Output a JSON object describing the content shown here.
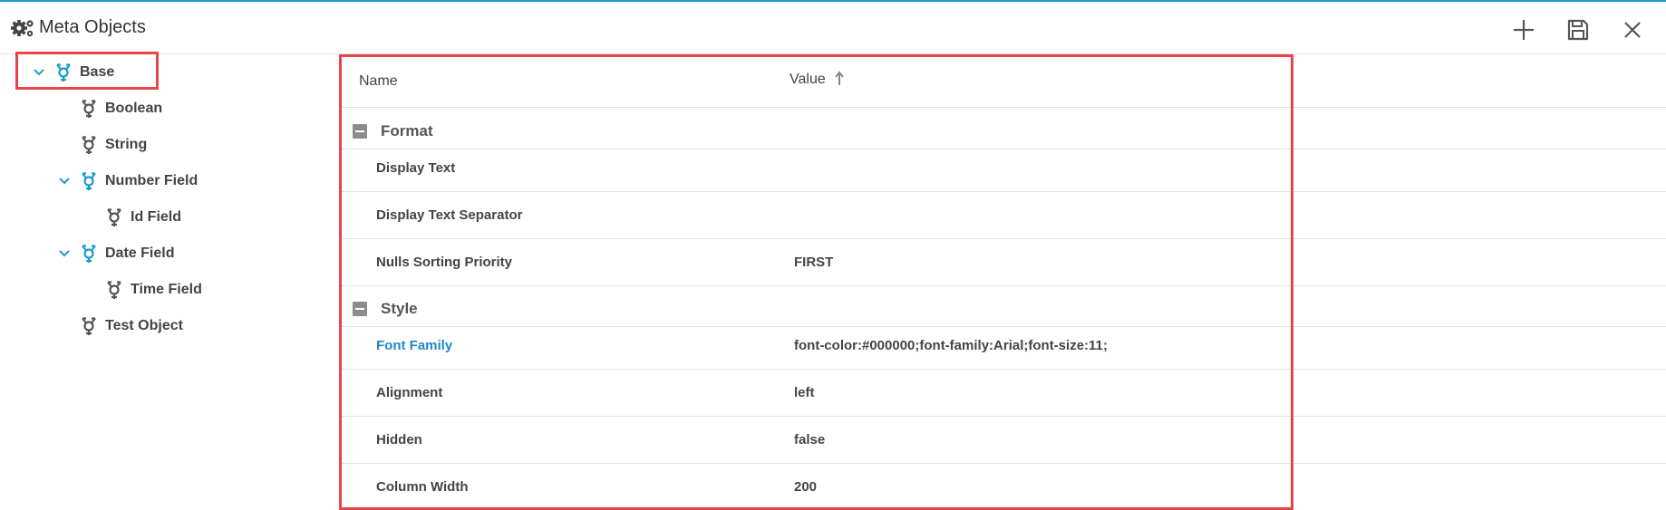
{
  "header": {
    "title": "Meta Objects",
    "title_icon": "gears-icon",
    "buttons": [
      {
        "name": "add-button",
        "icon": "plus-icon"
      },
      {
        "name": "save-button",
        "icon": "floppy-disk-icon"
      },
      {
        "name": "close-button",
        "icon": "close-icon"
      }
    ]
  },
  "tree": {
    "nodes": [
      {
        "label": "Base",
        "expanded": true,
        "selected": true,
        "accent": true
      },
      {
        "label": "Boolean"
      },
      {
        "label": "String"
      },
      {
        "label": "Number Field",
        "expanded": true,
        "accent": true
      },
      {
        "label": "Id Field"
      },
      {
        "label": "Date Field",
        "expanded": true,
        "accent": true
      },
      {
        "label": "Time Field"
      },
      {
        "label": "Test Object"
      }
    ]
  },
  "grid": {
    "columns": {
      "name": "Name",
      "value": "Value"
    },
    "groups": [
      {
        "label": "Format",
        "rows": [
          {
            "name": "Display Text",
            "value": ""
          },
          {
            "name": "Display Text Separator",
            "value": ""
          },
          {
            "name": "Nulls Sorting Priority",
            "value": "FIRST"
          }
        ]
      },
      {
        "label": "Style",
        "rows": [
          {
            "name": "Font Family",
            "value": "font-color:#000000;font-family:Arial;font-size:11;",
            "highlighted": true
          },
          {
            "name": "Alignment",
            "value": "left"
          },
          {
            "name": "Hidden",
            "value": "false"
          },
          {
            "name": "Column Width",
            "value": "200"
          }
        ]
      }
    ]
  },
  "colors": {
    "accent": "#1e9ad0",
    "link": "#1e88c7",
    "highlight_border": "#e8444a"
  }
}
